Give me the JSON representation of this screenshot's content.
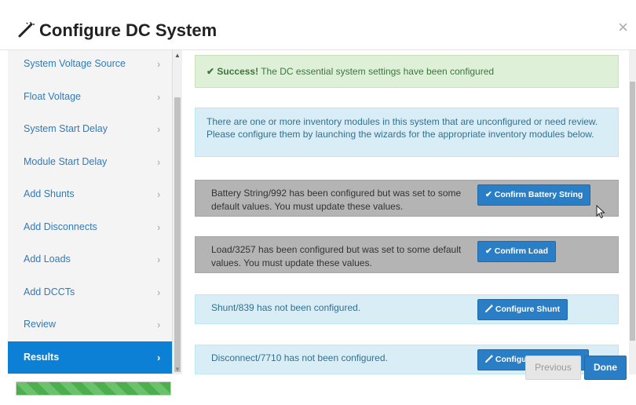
{
  "dialog": {
    "title": "Configure DC System",
    "close_glyph": "×",
    "title_icon": "magic-wand-icon"
  },
  "sidebar": {
    "items": [
      {
        "label": "System Voltage Source",
        "active": false
      },
      {
        "label": "Float Voltage",
        "active": false
      },
      {
        "label": "System Start Delay",
        "active": false
      },
      {
        "label": "Module Start Delay",
        "active": false
      },
      {
        "label": "Add Shunts",
        "active": false
      },
      {
        "label": "Add Disconnects",
        "active": false
      },
      {
        "label": "Add Loads",
        "active": false
      },
      {
        "label": "Add DCCTs",
        "active": false
      },
      {
        "label": "Review",
        "active": false
      },
      {
        "label": "Results",
        "active": true
      }
    ],
    "chevron": "›",
    "progress_fraction": 1.0
  },
  "main": {
    "success_strong": "Success!",
    "success_text": " The DC essential system settings have been configured",
    "info_text": "There are one or more inventory modules in this system that are unconfigured or need review. Please configure them by launching the wizards for the appropriate inventory modules below.",
    "tasks": [
      {
        "text": "Battery String/992 has been configured but was set to some default values. You must update these values.",
        "button": "Confirm Battery String",
        "icon": "checkmark-icon"
      },
      {
        "text": "Load/3257 has been configured but was set to some default values. You must update these values.",
        "button": "Confirm Load",
        "icon": "checkmark-icon"
      },
      {
        "text": "Shunt/839 has not been configured.",
        "button": "Configure Shunt",
        "icon": "magic-wand-icon"
      },
      {
        "text": "Disconnect/7710 has not been configured.",
        "button": "Configure Disconnect",
        "icon": "magic-wand-icon"
      }
    ]
  },
  "footer": {
    "previous_label": "Previous",
    "done_label": "Done"
  },
  "colors": {
    "accent": "#2a7ec6",
    "active_item": "#0b80d4",
    "success_bg": "#dff0d8",
    "info_bg": "#d9edf7",
    "warning_gray": "#b4b4b4"
  }
}
